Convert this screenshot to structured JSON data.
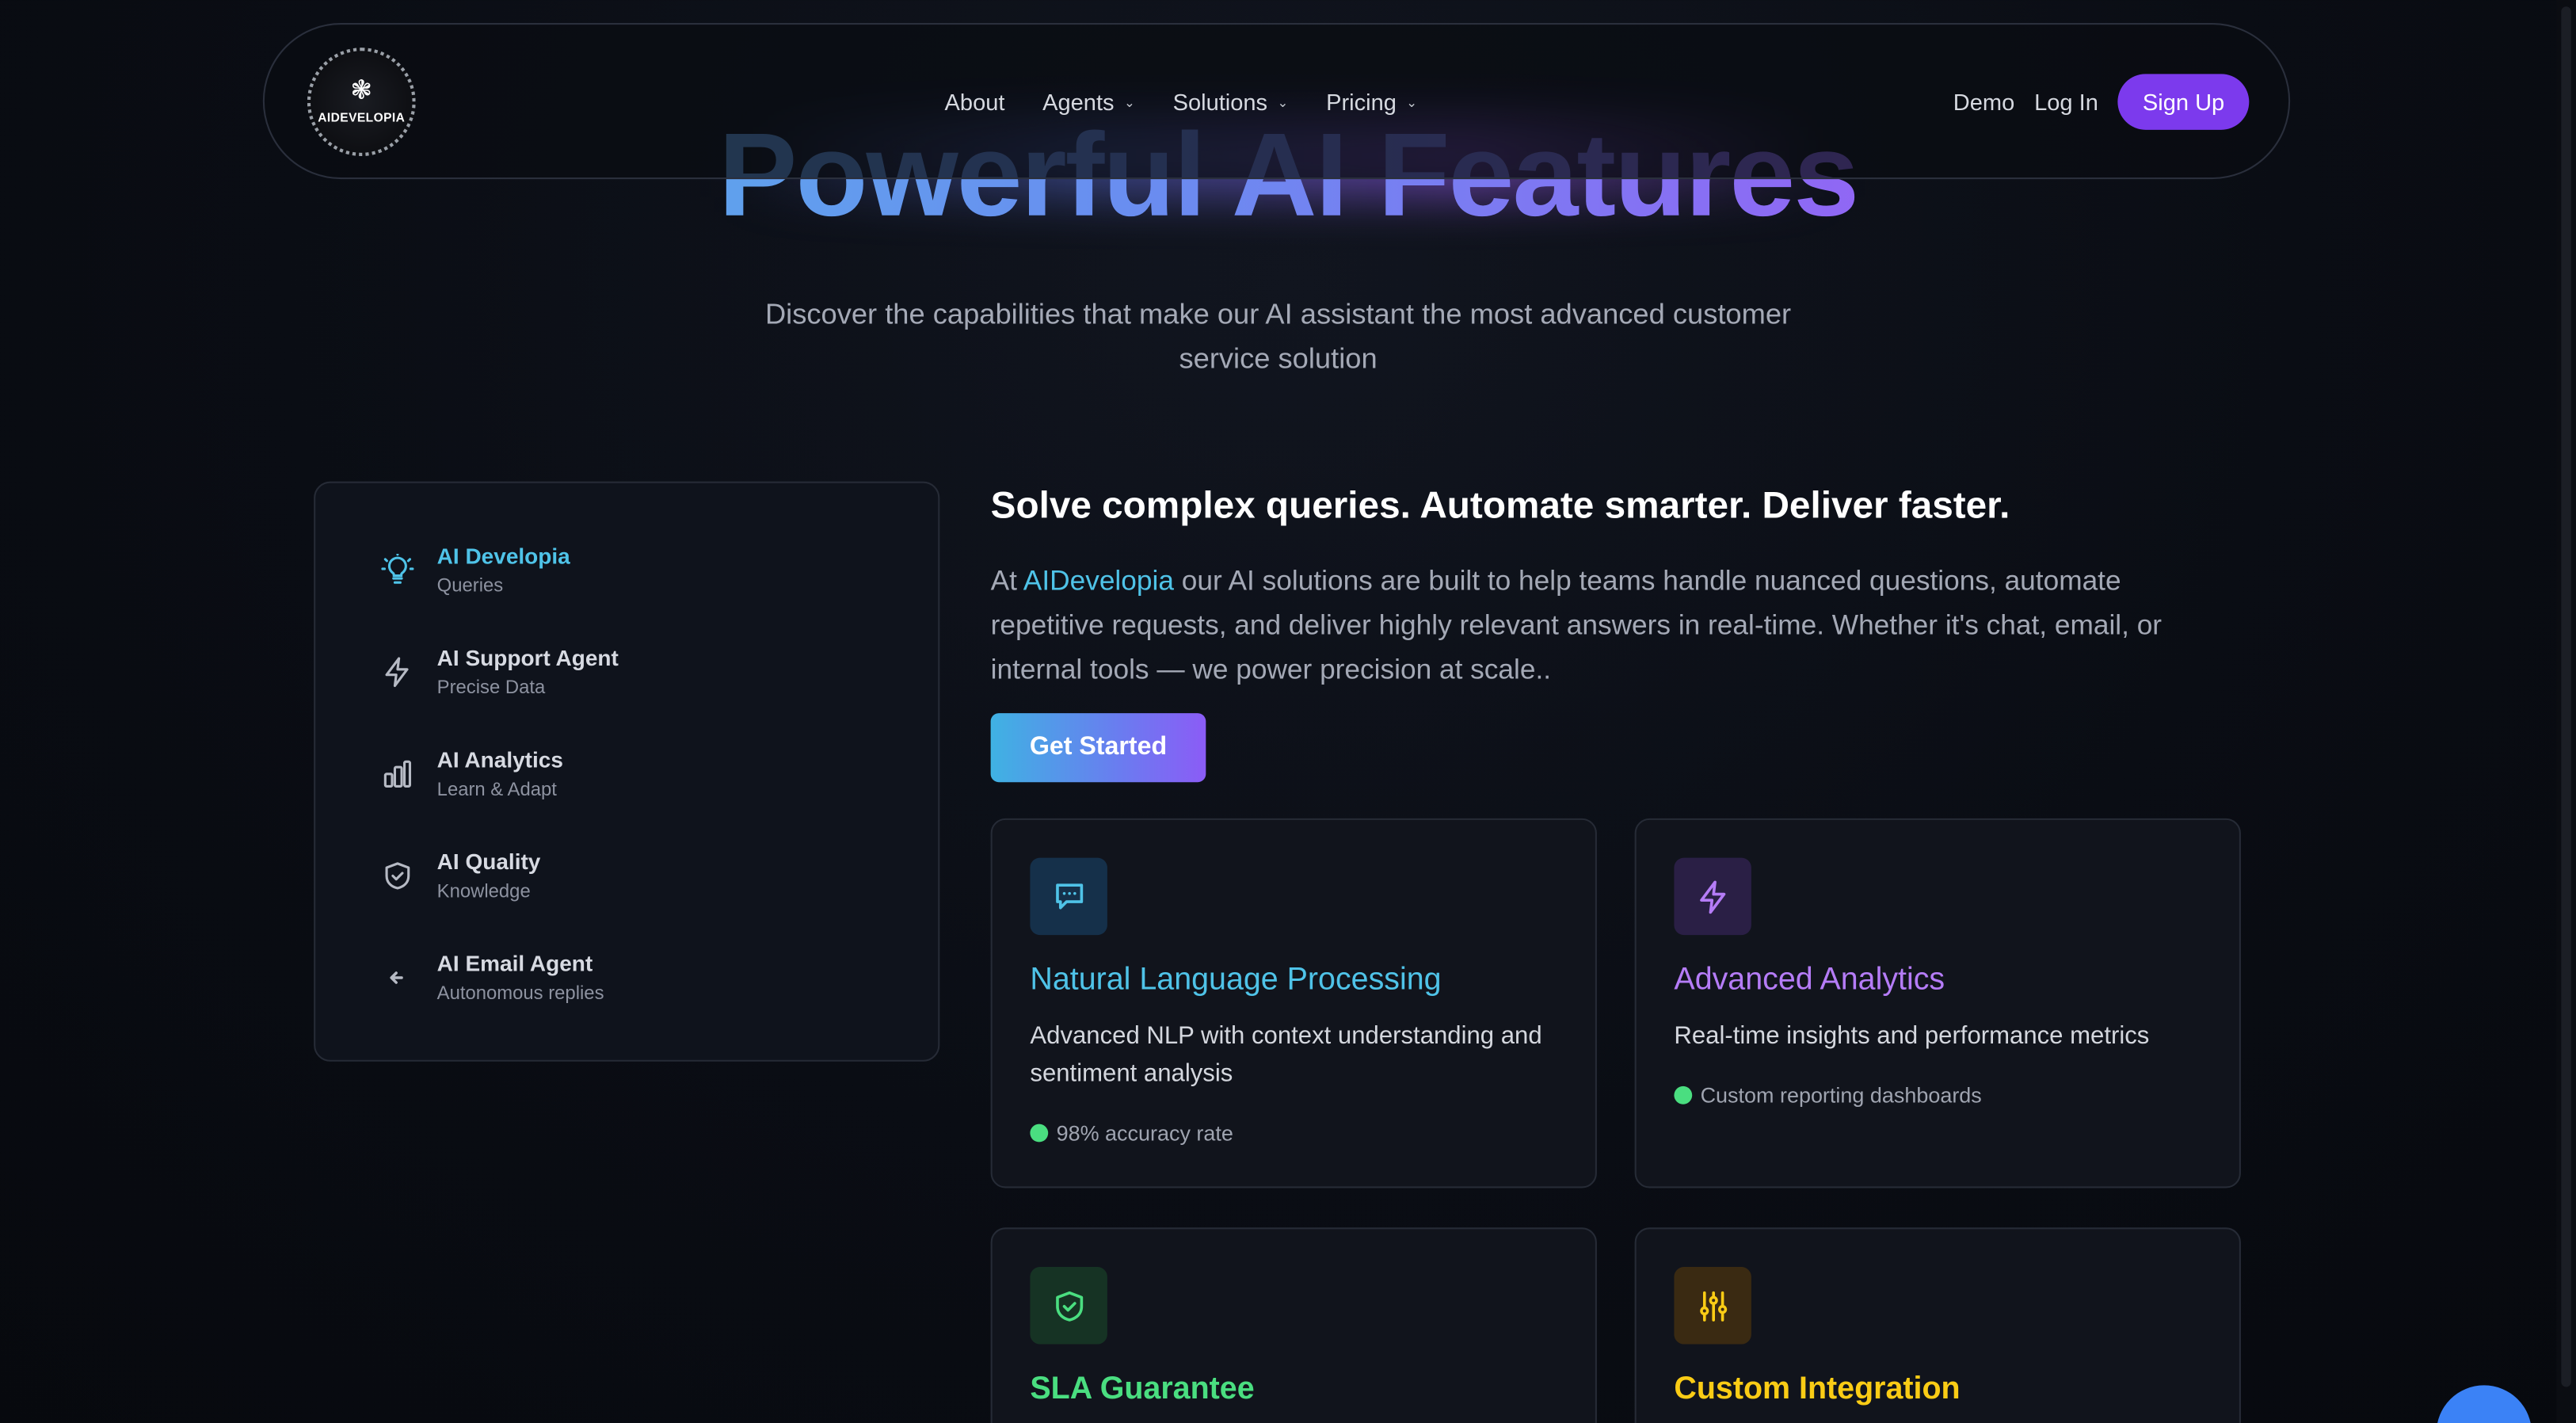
{
  "hero": {
    "title": "Powerful AI Features",
    "subtitle": "Discover the capabilities that make our AI assistant the most advanced customer service solution"
  },
  "nav": {
    "logo_text": "AIDEVELOPIA",
    "links": [
      {
        "label": "About",
        "dropdown": false
      },
      {
        "label": "Agents",
        "dropdown": true
      },
      {
        "label": "Solutions",
        "dropdown": true
      },
      {
        "label": "Pricing",
        "dropdown": true
      }
    ],
    "demo": "Demo",
    "login": "Log In",
    "signup": "Sign Up"
  },
  "sidebar": {
    "items": [
      {
        "title": "AI Developia",
        "desc": "Queries",
        "icon": "lightbulb-icon",
        "active": true
      },
      {
        "title": "AI Support Agent",
        "desc": "Precise Data",
        "icon": "lightning-icon",
        "active": false
      },
      {
        "title": "AI Analytics",
        "desc": "Learn & Adapt",
        "icon": "bar-chart-icon",
        "active": false
      },
      {
        "title": "AI Quality",
        "desc": "Knowledge",
        "icon": "shield-check-icon",
        "active": false
      },
      {
        "title": "AI Email Agent",
        "desc": "Autonomous replies",
        "icon": "arrow-left-icon",
        "active": false
      }
    ]
  },
  "main": {
    "headline": "Solve complex queries. Automate smarter. Deliver faster.",
    "para_prefix": "At ",
    "brand": "AIDevelopia",
    "para_suffix": " our AI solutions are built to help teams handle nuanced questions, automate repetitive requests, and deliver highly relevant answers in real-time. Whether it's chat, email, or internal tools — we power precision at scale..",
    "cta": "Get Started"
  },
  "cards": [
    {
      "title": "Natural Language Processing",
      "text": "Advanced NLP with context understanding and sentiment analysis",
      "feature": "98% accuracy rate",
      "icon": "chat-icon",
      "color": "#4fc3e8"
    },
    {
      "title": "Advanced Analytics",
      "text": "Real-time insights and performance metrics",
      "feature": "Custom reporting dashboards",
      "icon": "lightning-icon",
      "color": "#b57cf7"
    },
    {
      "title": "SLA Guarantee",
      "icon": "shield-check-icon",
      "color": "#4ade80"
    },
    {
      "title": "Custom Integration",
      "icon": "sliders-icon",
      "color": "#facc15"
    }
  ]
}
